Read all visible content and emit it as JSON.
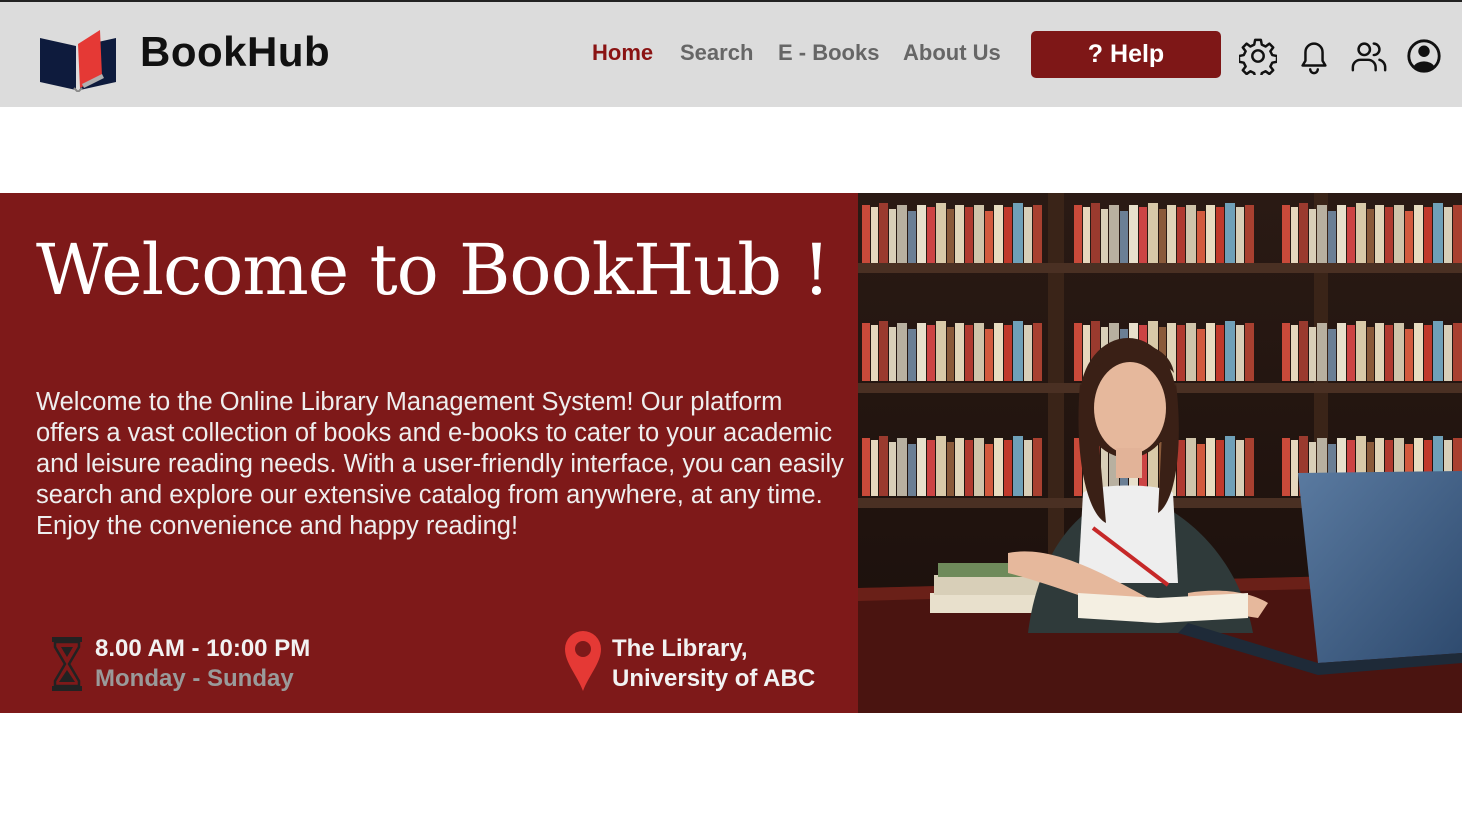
{
  "header": {
    "brand": "BookHub",
    "nav": [
      {
        "label": "Home",
        "active": true
      },
      {
        "label": "Search",
        "active": false
      },
      {
        "label": "E - Books",
        "active": false
      },
      {
        "label": "About Us",
        "active": false
      }
    ],
    "help_label": "? Help",
    "icons": [
      "gear-icon",
      "bell-icon",
      "users-icon",
      "user-profile-icon"
    ]
  },
  "hero": {
    "title": "Welcome to BookHub !",
    "description": "Welcome to the Online Library Management System! Our platform offers a vast collection of books and e-books to cater to your academic and leisure reading needs. With a user-friendly interface, you can easily search and explore our extensive catalog from anywhere, at any time. Enjoy the convenience and happy reading!",
    "hours": {
      "time": "8.00 AM - 10:00 PM",
      "days": "Monday - Sunday"
    },
    "location": {
      "line1": "The Library,",
      "line2": "University of ABC"
    }
  },
  "colors": {
    "accent": "#7e1919",
    "header_bg": "#dcdcdc",
    "nav_active": "#8a1313",
    "nav_inactive": "#666666",
    "pin": "#e53935"
  }
}
